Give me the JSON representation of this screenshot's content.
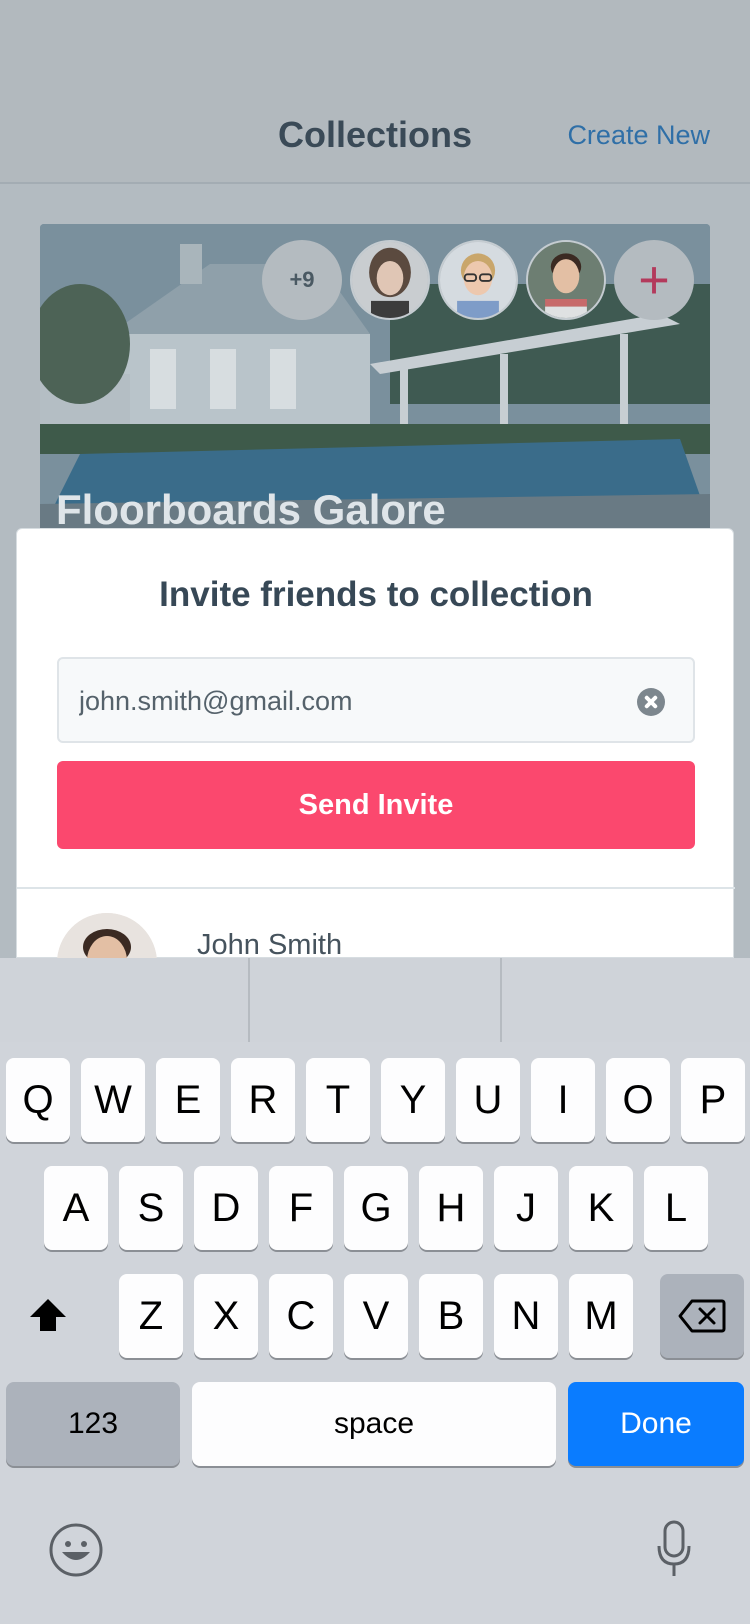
{
  "header": {
    "title": "Collections",
    "create_label": "Create New"
  },
  "collection": {
    "title": "Floorboards Galore",
    "member_overflow": "+9",
    "add_member_label": "+"
  },
  "invite": {
    "title": "Invite friends to collection",
    "email_value": "john.smith@gmail.com",
    "send_label": "Send Invite",
    "results": [
      {
        "name": "John Smith"
      }
    ]
  },
  "keyboard": {
    "row1": [
      "Q",
      "W",
      "E",
      "R",
      "T",
      "Y",
      "U",
      "I",
      "O",
      "P"
    ],
    "row2": [
      "A",
      "S",
      "D",
      "F",
      "G",
      "H",
      "J",
      "K",
      "L"
    ],
    "row3": [
      "Z",
      "X",
      "C",
      "V",
      "B",
      "N",
      "M"
    ],
    "numbers_label": "123",
    "space_label": "space",
    "done_label": "Done"
  },
  "colors": {
    "accent": "#fb486e",
    "link": "#2f6fa7",
    "done": "#0a7cff"
  }
}
